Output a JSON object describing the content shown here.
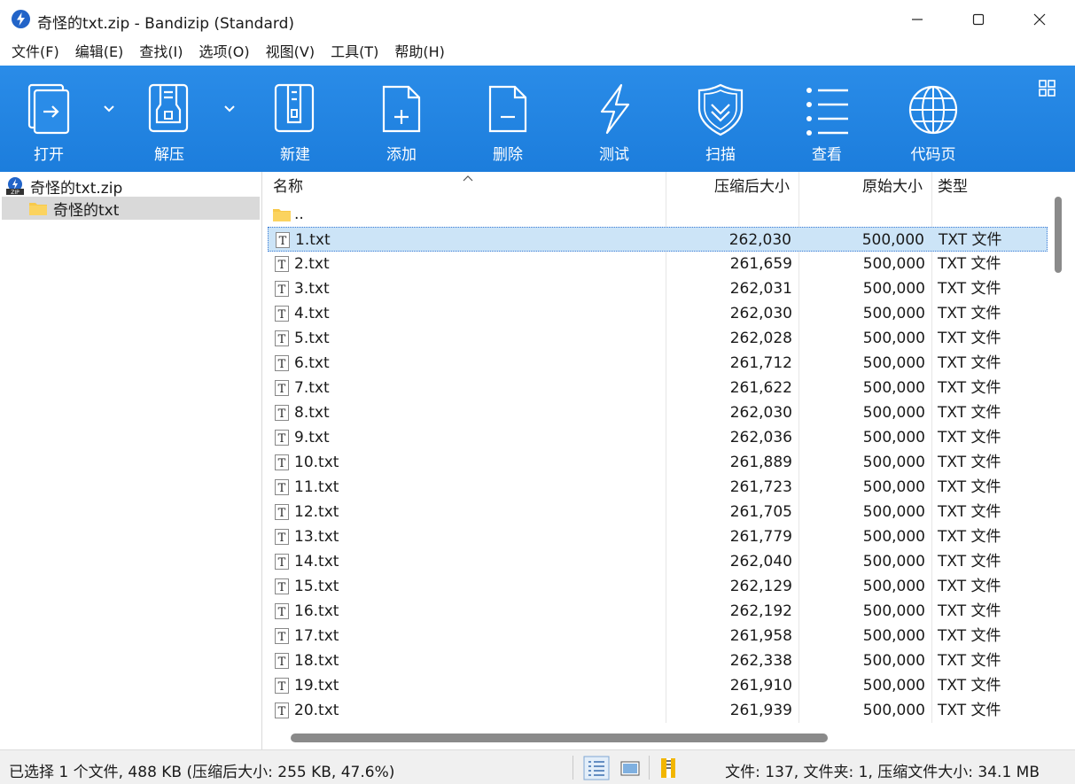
{
  "window": {
    "title": "奇怪的txt.zip - Bandizip (Standard)"
  },
  "menu": [
    "文件(F)",
    "编辑(E)",
    "查找(I)",
    "选项(O)",
    "视图(V)",
    "工具(T)",
    "帮助(H)"
  ],
  "toolbar": {
    "open": "打开",
    "extract": "解压",
    "new": "新建",
    "add": "添加",
    "delete": "删除",
    "test": "测试",
    "scan": "扫描",
    "view": "查看",
    "codepage": "代码页"
  },
  "tree": {
    "root": "奇怪的txt.zip",
    "folder": "奇怪的txt"
  },
  "columns": {
    "name": "名称",
    "compressed": "压缩后大小",
    "original": "原始大小",
    "type": "类型"
  },
  "parent_row": "..",
  "files": [
    {
      "name": "1.txt",
      "compressed": "262,030",
      "original": "500,000",
      "type": "TXT 文件"
    },
    {
      "name": "2.txt",
      "compressed": "261,659",
      "original": "500,000",
      "type": "TXT 文件"
    },
    {
      "name": "3.txt",
      "compressed": "262,031",
      "original": "500,000",
      "type": "TXT 文件"
    },
    {
      "name": "4.txt",
      "compressed": "262,030",
      "original": "500,000",
      "type": "TXT 文件"
    },
    {
      "name": "5.txt",
      "compressed": "262,028",
      "original": "500,000",
      "type": "TXT 文件"
    },
    {
      "name": "6.txt",
      "compressed": "261,712",
      "original": "500,000",
      "type": "TXT 文件"
    },
    {
      "name": "7.txt",
      "compressed": "261,622",
      "original": "500,000",
      "type": "TXT 文件"
    },
    {
      "name": "8.txt",
      "compressed": "262,030",
      "original": "500,000",
      "type": "TXT 文件"
    },
    {
      "name": "9.txt",
      "compressed": "262,036",
      "original": "500,000",
      "type": "TXT 文件"
    },
    {
      "name": "10.txt",
      "compressed": "261,889",
      "original": "500,000",
      "type": "TXT 文件"
    },
    {
      "name": "11.txt",
      "compressed": "261,723",
      "original": "500,000",
      "type": "TXT 文件"
    },
    {
      "name": "12.txt",
      "compressed": "261,705",
      "original": "500,000",
      "type": "TXT 文件"
    },
    {
      "name": "13.txt",
      "compressed": "261,779",
      "original": "500,000",
      "type": "TXT 文件"
    },
    {
      "name": "14.txt",
      "compressed": "262,040",
      "original": "500,000",
      "type": "TXT 文件"
    },
    {
      "name": "15.txt",
      "compressed": "262,129",
      "original": "500,000",
      "type": "TXT 文件"
    },
    {
      "name": "16.txt",
      "compressed": "262,192",
      "original": "500,000",
      "type": "TXT 文件"
    },
    {
      "name": "17.txt",
      "compressed": "261,958",
      "original": "500,000",
      "type": "TXT 文件"
    },
    {
      "name": "18.txt",
      "compressed": "262,338",
      "original": "500,000",
      "type": "TXT 文件"
    },
    {
      "name": "19.txt",
      "compressed": "261,910",
      "original": "500,000",
      "type": "TXT 文件"
    },
    {
      "name": "20.txt",
      "compressed": "261,939",
      "original": "500,000",
      "type": "TXT 文件"
    }
  ],
  "selected_file": "1.txt",
  "status": {
    "left": "已选择 1 个文件, 488 KB (压缩后大小: 255 KB, 47.6%)",
    "right": "文件: 137, 文件夹: 1, 压缩文件大小: 34.1 MB"
  },
  "colors": {
    "toolbar_blue": "#1f84e2",
    "selection": "#cce4f7",
    "folder_yellow": "#f8c94a"
  }
}
